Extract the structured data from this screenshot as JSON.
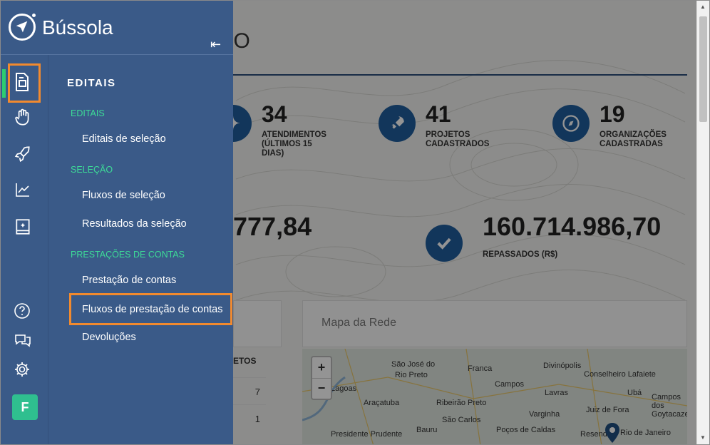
{
  "app": {
    "brand": "Bússola",
    "avatar_letter": "F"
  },
  "dashboard": {
    "title_fragment": "ATIVO",
    "stats": [
      {
        "num": "34",
        "label": "ATENDIMENTOS (ÚLTIMOS 15 DIAS)",
        "icon": "rocket"
      },
      {
        "num": "41",
        "label": "PROJETOS CADASTRADOS",
        "icon": "rocket-icon"
      },
      {
        "num": "19",
        "label": "ORGANIZAÇÕES CADASTRADAS",
        "icon": "compass-icon"
      }
    ],
    "partial_value": "777,84",
    "repassados_value": "160.714.986,70",
    "repassados_label": "REPASSADOS (R$)",
    "map_title": "Mapa da Rede",
    "table_header_fragment": "ETOS",
    "table_values": [
      "7",
      "1"
    ],
    "map_cities": [
      "São José do",
      "Rio Preto",
      "Franca",
      "Divinópolis",
      "Lagoas",
      "Campos",
      "Lavras",
      "Conselheiro Lafaiete",
      "Ubá",
      "Araçatuba",
      "Ribeirão Preto",
      "São Carlos",
      "Juiz de Fora",
      "Campos dos Goytacazes",
      "Varginha",
      "Poços de Caldas",
      "Bauru",
      "Presidente Prudente",
      "Resende",
      "Rio de Janeiro"
    ]
  },
  "sidebar": {
    "section_title": "EDITAIS",
    "groups": [
      {
        "label": "EDITAIS",
        "items": [
          "Editais de seleção"
        ]
      },
      {
        "label": "SELEÇÃO",
        "items": [
          "Fluxos de seleção",
          "Resultados da seleção"
        ]
      },
      {
        "label": "PRESTAÇÕES DE CONTAS",
        "items": [
          "Prestação de contas",
          "Fluxos de prestação de contas",
          "Devoluções"
        ]
      }
    ]
  },
  "accent": {
    "orange": "#f28a2e",
    "green": "#2ecc71",
    "sidebar": "#3a5a88"
  }
}
